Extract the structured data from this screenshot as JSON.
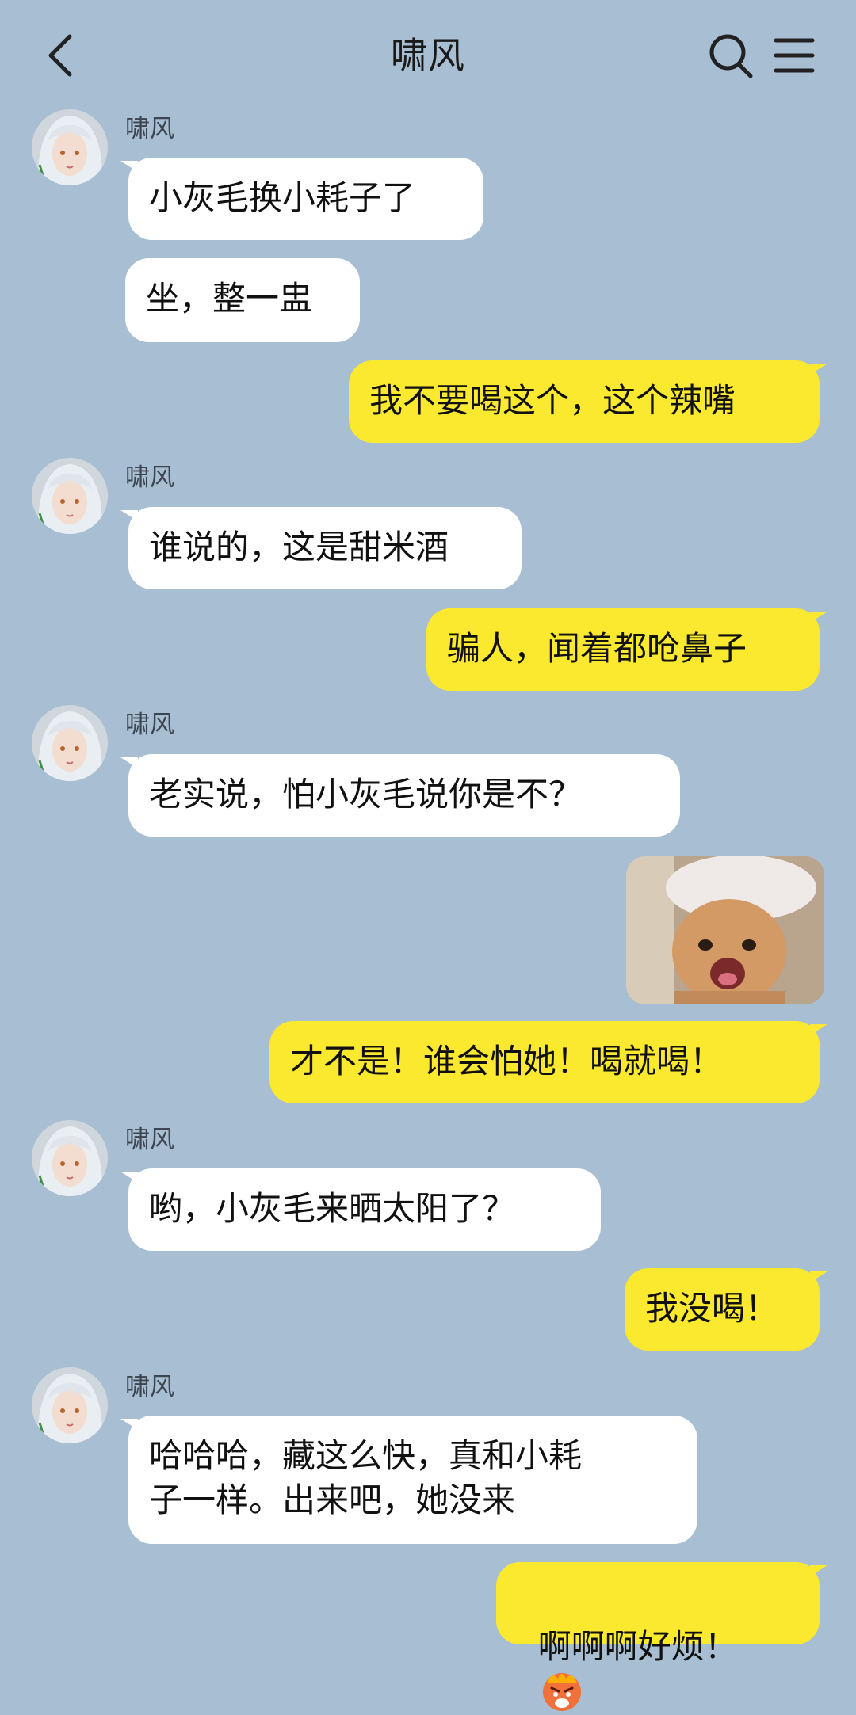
{
  "header": {
    "title": "啸风"
  },
  "icons": {
    "back": "chevron-left-icon",
    "search": "search-icon",
    "menu": "hamburger-menu-icon",
    "angry_emoji": "angry-face-emoji-icon"
  },
  "colors": {
    "background": "#a8bfd3",
    "incoming_bubble": "#ffffff",
    "outgoing_bubble": "#fbe92f"
  },
  "messages": [
    {
      "from": "啸风",
      "text": "小灰毛换小耗子了"
    },
    {
      "from": "啸风",
      "text": "坐，整一盅"
    },
    {
      "from": "me",
      "text": "我不要喝这个，这个辣嘴"
    },
    {
      "from": "啸风",
      "text": "谁说的，这是甜米酒"
    },
    {
      "from": "me",
      "text": "骗人，闻着都呛鼻子"
    },
    {
      "from": "啸风",
      "text": "老实说，怕小灰毛说你是不？"
    },
    {
      "from": "me",
      "type": "sticker",
      "sticker": "crying-kitten-sticker"
    },
    {
      "from": "me",
      "text": "才不是！谁会怕她！喝就喝！"
    },
    {
      "from": "啸风",
      "text": "哟，小灰毛来晒太阳了？"
    },
    {
      "from": "me",
      "text": "我没喝！"
    },
    {
      "from": "啸风",
      "text": "哈哈哈，藏这么快，真和小耗\n子一样。出来吧，她没来"
    },
    {
      "from": "me",
      "text": "啊啊啊好烦！"
    }
  ]
}
